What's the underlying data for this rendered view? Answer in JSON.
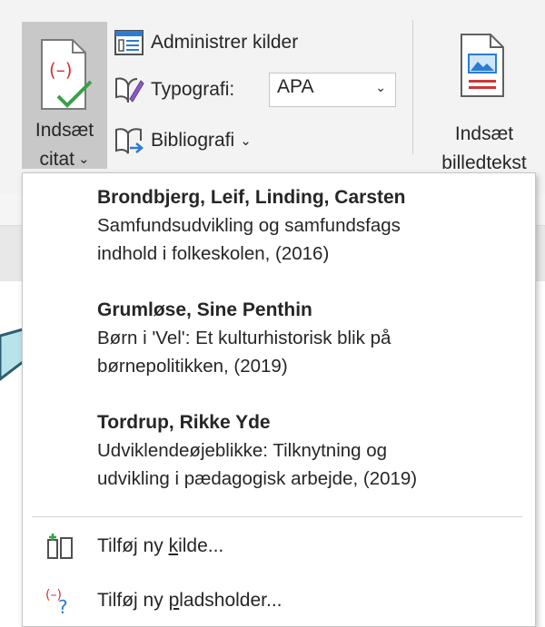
{
  "ribbon": {
    "insert_citation": {
      "line1": "Indsæt",
      "line2": "citat",
      "chevron": "⌄"
    },
    "manage_sources": "Administrer kilder",
    "style": {
      "label": "Typografi:",
      "value": "APA"
    },
    "bibliography": {
      "label": "Bibliografi",
      "chevron": "⌄"
    },
    "insert_caption": {
      "line1": "Indsæt",
      "line2": "billedtekst"
    }
  },
  "sources": [
    {
      "authors": "Brondbjerg, Leif,  Linding, Carsten",
      "title_line1": "Samfundsudvikling og samfundsfags",
      "title_line2": "indhold i folkeskolen, (2016)"
    },
    {
      "authors": "Grumløse, Sine Penthin",
      "title_line1": "Børn i 'Vel': Et kulturhistorisk blik på",
      "title_line2": "børnepolitikken, (2019)"
    },
    {
      "authors": "Tordrup, Rikke Yde",
      "title_line1": "Udviklendeøjeblikke: Tilknytning og",
      "title_line2": "udvikling i pædagogisk arbejde, (2019)"
    }
  ],
  "menu": {
    "add_source": {
      "pre": "Tilføj ny ",
      "key": "k",
      "post": "ilde..."
    },
    "add_placeholder": {
      "pre": "Tilføj ny ",
      "key": "p",
      "post": "ladsholder..."
    }
  },
  "colors": {
    "accent_red": "#d13438",
    "accent_green": "#3a9f4a",
    "accent_blue": "#2b7cd3",
    "callout": "#b9e3ea",
    "callout_border": "#2d5d72"
  },
  "icons": [
    "citation-icon",
    "manage-sources-icon",
    "style-icon",
    "bibliography-icon",
    "caption-icon",
    "add-source-icon",
    "placeholder-icon"
  ]
}
